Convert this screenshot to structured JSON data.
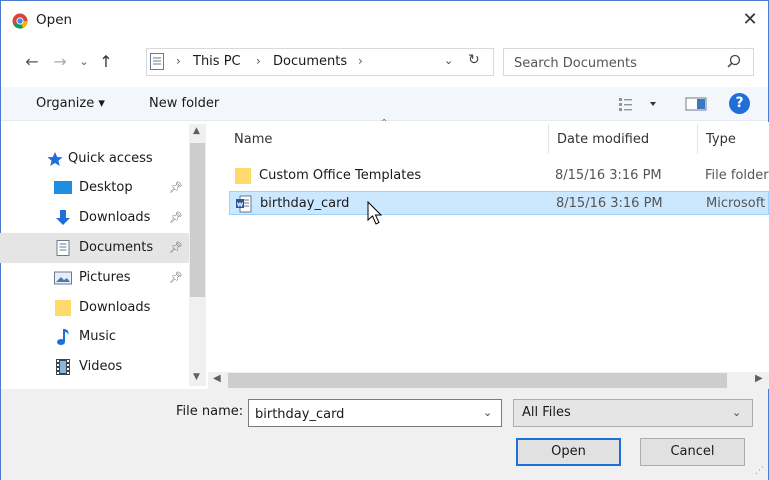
{
  "window": {
    "title": "Open",
    "close_glyph": "✕",
    "icon": "chrome-icon",
    "accent": "#1e6fd9"
  },
  "nav_buttons": {
    "back": "←",
    "forward": "→",
    "recent": "⌄",
    "up": "↑"
  },
  "address": {
    "crumbs": [
      "This PC",
      "Documents"
    ],
    "separator": "›",
    "dropdown": "⌄",
    "refresh": "↻"
  },
  "search": {
    "placeholder": "Search Documents"
  },
  "toolbar": {
    "organize_label": "Organize ▾",
    "newfolder_label": "New folder"
  },
  "sidebar": {
    "items": [
      {
        "label": "Quick access",
        "icon": "star-icon"
      },
      {
        "label": "Desktop",
        "icon": "desktop-icon",
        "pinned": true
      },
      {
        "label": "Downloads",
        "icon": "download-icon",
        "pinned": true
      },
      {
        "label": "Documents",
        "icon": "documents-icon",
        "pinned": true,
        "selected": true
      },
      {
        "label": "Pictures",
        "icon": "pictures-icon",
        "pinned": true
      },
      {
        "label": "Downloads",
        "icon": "folder-icon"
      },
      {
        "label": "Music",
        "icon": "music-icon"
      },
      {
        "label": "Videos",
        "icon": "videos-icon"
      }
    ]
  },
  "columns": {
    "name": "Name",
    "date": "Date modified",
    "type": "Type"
  },
  "files": [
    {
      "name": "Custom Office Templates",
      "date": "8/15/16 3:16 PM",
      "type": "File folder",
      "icon": "folder-icon",
      "selected": false
    },
    {
      "name": "birthday_card",
      "date": "8/15/16 3:16 PM",
      "type": "Microsoft",
      "icon": "word-doc-icon",
      "selected": true
    }
  ],
  "bottom": {
    "filename_label": "File name:",
    "filename_value": "birthday_card",
    "filter": "All Files",
    "open_label": "Open",
    "cancel_label": "Cancel"
  }
}
